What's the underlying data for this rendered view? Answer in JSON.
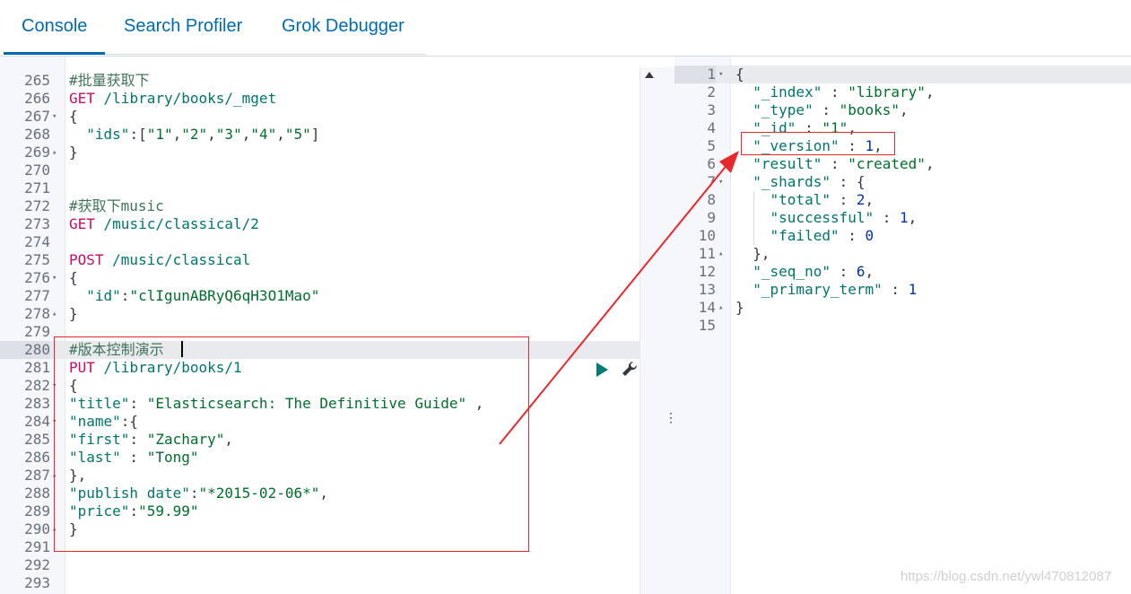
{
  "tabs": [
    {
      "label": "Console",
      "active": true
    },
    {
      "label": "Search Profiler",
      "active": false
    },
    {
      "label": "Grok Debugger",
      "active": false
    }
  ],
  "colors": {
    "accent": "#006bb4",
    "annotation": "#e7282d",
    "run_button": "#017d73"
  },
  "request_editor": {
    "lines": [
      {
        "n": "265",
        "fold": "",
        "tokens": [
          [
            "#批量获取下",
            "c-comment"
          ]
        ]
      },
      {
        "n": "266",
        "fold": "",
        "tokens": [
          [
            "GET",
            "c-method"
          ],
          [
            " /library/books/_mget",
            "c-url"
          ]
        ]
      },
      {
        "n": "267",
        "fold": "▾",
        "tokens": [
          [
            "{",
            "c-punc"
          ]
        ]
      },
      {
        "n": "268",
        "fold": "",
        "tokens": [
          [
            "  \"ids\"",
            "c-key"
          ],
          [
            ":[",
            "c-punc"
          ],
          [
            "\"1\"",
            "c-str"
          ],
          [
            ",",
            "c-punc"
          ],
          [
            "\"2\"",
            "c-str"
          ],
          [
            ",",
            "c-punc"
          ],
          [
            "\"3\"",
            "c-str"
          ],
          [
            ",",
            "c-punc"
          ],
          [
            "\"4\"",
            "c-str"
          ],
          [
            ",",
            "c-punc"
          ],
          [
            "\"5\"",
            "c-str"
          ],
          [
            "]",
            "c-punc"
          ]
        ]
      },
      {
        "n": "269",
        "fold": "▴",
        "tokens": [
          [
            "}",
            "c-punc"
          ]
        ]
      },
      {
        "n": "270",
        "fold": "",
        "tokens": []
      },
      {
        "n": "271",
        "fold": "",
        "tokens": []
      },
      {
        "n": "272",
        "fold": "",
        "tokens": [
          [
            "#获取下music",
            "c-comment"
          ]
        ]
      },
      {
        "n": "273",
        "fold": "",
        "tokens": [
          [
            "GET",
            "c-method"
          ],
          [
            " /music/classical/2",
            "c-url"
          ]
        ]
      },
      {
        "n": "274",
        "fold": "",
        "tokens": []
      },
      {
        "n": "275",
        "fold": "",
        "tokens": [
          [
            "POST",
            "c-method"
          ],
          [
            " /music/classical",
            "c-url"
          ]
        ]
      },
      {
        "n": "276",
        "fold": "▾",
        "tokens": [
          [
            "{",
            "c-punc"
          ]
        ]
      },
      {
        "n": "277",
        "fold": "",
        "tokens": [
          [
            "  \"id\"",
            "c-key"
          ],
          [
            ":",
            "c-punc"
          ],
          [
            "\"clIgunABRyQ6qH3O1Mao\"",
            "c-str"
          ]
        ]
      },
      {
        "n": "278",
        "fold": "▴",
        "tokens": [
          [
            "}",
            "c-punc"
          ]
        ]
      },
      {
        "n": "279",
        "fold": "",
        "tokens": []
      },
      {
        "n": "280",
        "fold": "",
        "tokens": [
          [
            "#版本控制演示",
            "c-comment"
          ]
        ],
        "highlight": true
      },
      {
        "n": "281",
        "fold": "",
        "tokens": [
          [
            "PUT",
            "c-method"
          ],
          [
            " /library/books/1",
            "c-url"
          ]
        ]
      },
      {
        "n": "282",
        "fold": "▾",
        "tokens": [
          [
            "{",
            "c-punc"
          ]
        ]
      },
      {
        "n": "283",
        "fold": "",
        "tokens": [
          [
            "\"title\"",
            "c-key"
          ],
          [
            ": ",
            "c-punc"
          ],
          [
            "\"Elasticsearch: The Definitive Guide\"",
            "c-str"
          ],
          [
            " ,",
            "c-punc"
          ]
        ]
      },
      {
        "n": "284",
        "fold": "▾",
        "tokens": [
          [
            "\"name\"",
            "c-key"
          ],
          [
            ":{",
            "c-punc"
          ]
        ]
      },
      {
        "n": "285",
        "fold": "",
        "tokens": [
          [
            "\"first\"",
            "c-key"
          ],
          [
            ": ",
            "c-punc"
          ],
          [
            "\"Zachary\"",
            "c-str"
          ],
          [
            ",",
            "c-punc"
          ]
        ]
      },
      {
        "n": "286",
        "fold": "",
        "tokens": [
          [
            "\"last\"",
            "c-key"
          ],
          [
            " : ",
            "c-punc"
          ],
          [
            "\"Tong\"",
            "c-str"
          ]
        ]
      },
      {
        "n": "287",
        "fold": "▴",
        "tokens": [
          [
            "},",
            "c-punc"
          ]
        ]
      },
      {
        "n": "288",
        "fold": "",
        "tokens": [
          [
            "\"publish date\"",
            "c-key"
          ],
          [
            ":",
            "c-punc"
          ],
          [
            "\"*2015-02-06*\"",
            "c-str"
          ],
          [
            ",",
            "c-punc"
          ]
        ]
      },
      {
        "n": "289",
        "fold": "",
        "tokens": [
          [
            "\"price\"",
            "c-key"
          ],
          [
            ":",
            "c-punc"
          ],
          [
            "\"59.99\"",
            "c-str"
          ]
        ]
      },
      {
        "n": "290",
        "fold": "▴",
        "tokens": [
          [
            "}",
            "c-punc"
          ]
        ]
      },
      {
        "n": "291",
        "fold": "",
        "tokens": []
      },
      {
        "n": "292",
        "fold": "",
        "tokens": []
      },
      {
        "n": "293",
        "fold": "",
        "tokens": []
      }
    ]
  },
  "response_editor": {
    "lines": [
      {
        "n": "1",
        "fold": "▾",
        "tokens": [
          [
            "{",
            "c-punc"
          ]
        ],
        "highlight": true
      },
      {
        "n": "2",
        "fold": "",
        "tokens": [
          [
            "  \"_index\"",
            "c-key"
          ],
          [
            " : ",
            "c-punc"
          ],
          [
            "\"library\"",
            "c-str"
          ],
          [
            ",",
            "c-punc"
          ]
        ]
      },
      {
        "n": "3",
        "fold": "",
        "tokens": [
          [
            "  \"_type\"",
            "c-key"
          ],
          [
            " : ",
            "c-punc"
          ],
          [
            "\"books\"",
            "c-str"
          ],
          [
            ",",
            "c-punc"
          ]
        ]
      },
      {
        "n": "4",
        "fold": "",
        "tokens": [
          [
            "  \"_id\"",
            "c-key"
          ],
          [
            " : ",
            "c-punc"
          ],
          [
            "\"1\"",
            "c-str"
          ],
          [
            ",",
            "c-punc"
          ]
        ]
      },
      {
        "n": "5",
        "fold": "",
        "tokens": [
          [
            "  \"_version\"",
            "c-key"
          ],
          [
            " : ",
            "c-punc"
          ],
          [
            "1",
            "c-num"
          ],
          [
            ",",
            "c-punc"
          ]
        ]
      },
      {
        "n": "6",
        "fold": "",
        "tokens": [
          [
            "  \"result\"",
            "c-key"
          ],
          [
            " : ",
            "c-punc"
          ],
          [
            "\"created\"",
            "c-str"
          ],
          [
            ",",
            "c-punc"
          ]
        ]
      },
      {
        "n": "7",
        "fold": "▾",
        "tokens": [
          [
            "  \"_shards\"",
            "c-key"
          ],
          [
            " : {",
            "c-punc"
          ]
        ]
      },
      {
        "n": "8",
        "fold": "",
        "tokens": [
          [
            "    \"total\"",
            "c-key"
          ],
          [
            " : ",
            "c-punc"
          ],
          [
            "2",
            "c-num"
          ],
          [
            ",",
            "c-punc"
          ]
        ]
      },
      {
        "n": "9",
        "fold": "",
        "tokens": [
          [
            "    \"successful\"",
            "c-key"
          ],
          [
            " : ",
            "c-punc"
          ],
          [
            "1",
            "c-num"
          ],
          [
            ",",
            "c-punc"
          ]
        ]
      },
      {
        "n": "10",
        "fold": "",
        "tokens": [
          [
            "    \"failed\"",
            "c-key"
          ],
          [
            " : ",
            "c-punc"
          ],
          [
            "0",
            "c-num"
          ]
        ]
      },
      {
        "n": "11",
        "fold": "▴",
        "tokens": [
          [
            "  },",
            "c-punc"
          ]
        ]
      },
      {
        "n": "12",
        "fold": "",
        "tokens": [
          [
            "  \"_seq_no\"",
            "c-key"
          ],
          [
            " : ",
            "c-punc"
          ],
          [
            "6",
            "c-num"
          ],
          [
            ",",
            "c-punc"
          ]
        ]
      },
      {
        "n": "13",
        "fold": "",
        "tokens": [
          [
            "  \"_primary_term\"",
            "c-key"
          ],
          [
            " : ",
            "c-punc"
          ],
          [
            "1",
            "c-num"
          ]
        ]
      },
      {
        "n": "14",
        "fold": "▴",
        "tokens": [
          [
            "}",
            "c-punc"
          ]
        ]
      },
      {
        "n": "15",
        "fold": "",
        "tokens": []
      }
    ]
  },
  "icons": {
    "run": "play-icon",
    "settings": "wrench-icon",
    "resize": "vertical-dots-icon",
    "scroll": "scroll-up-arrow-icon"
  },
  "watermark": "https://blog.csdn.net/ywl470812087"
}
